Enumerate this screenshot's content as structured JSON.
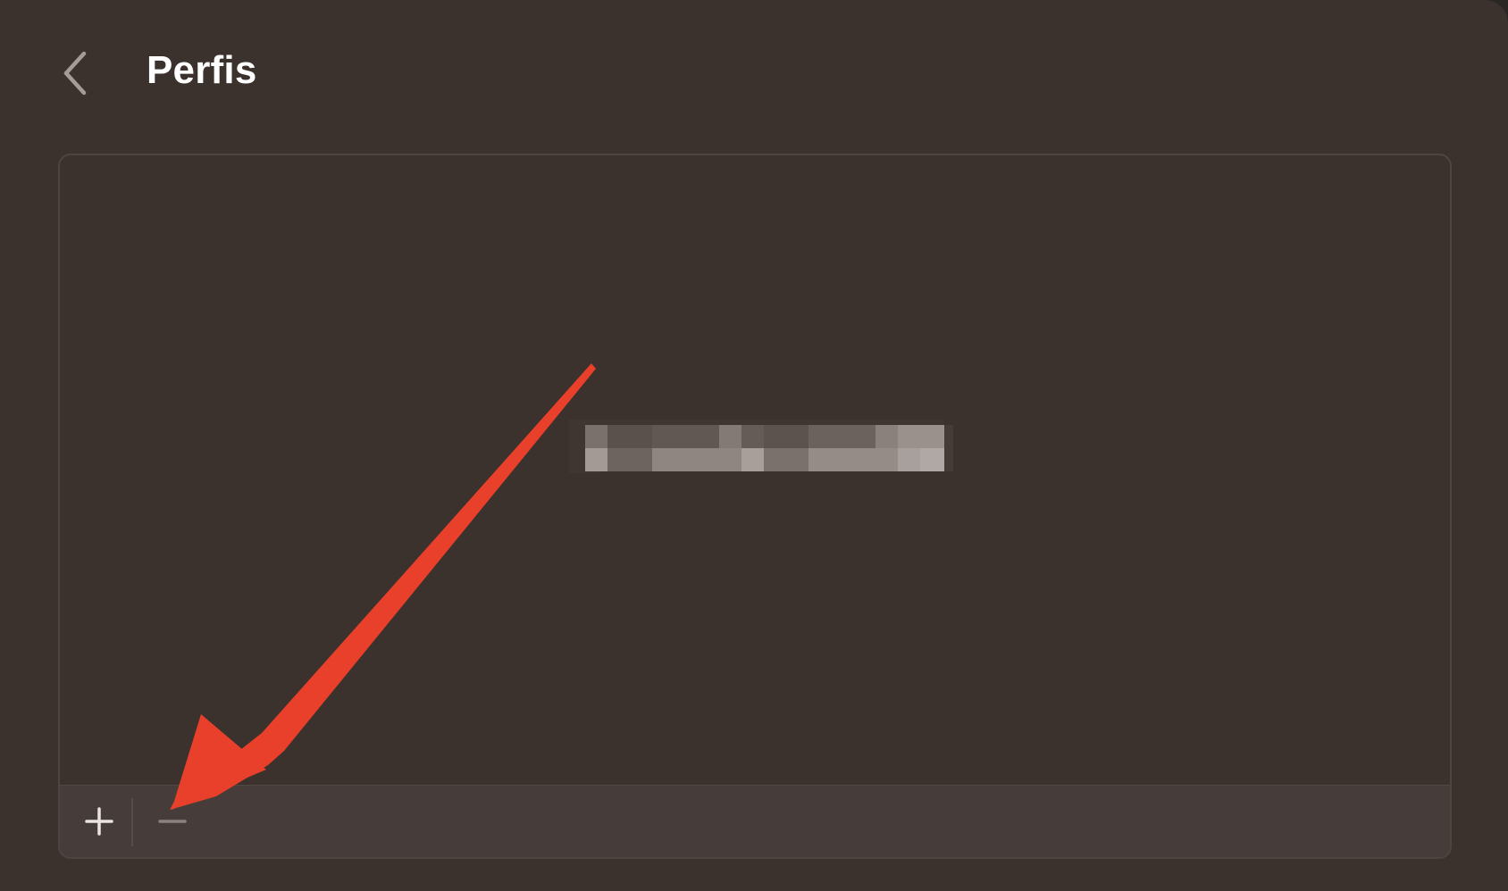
{
  "header": {
    "title": "Perfis",
    "back_icon": "chevron-left-icon"
  },
  "profiles": {
    "items": [
      {
        "label_state": "pixelated"
      }
    ]
  },
  "toolbar": {
    "add_icon": "plus-icon",
    "remove_icon": "minus-icon"
  },
  "annotation": {
    "type": "arrow",
    "target": "remove-profile-button",
    "color": "#e8402b"
  },
  "colors": {
    "background": "#3b312d",
    "toolbar": "#463c39",
    "title": "#ffffff",
    "arrow": "#e8402b"
  }
}
